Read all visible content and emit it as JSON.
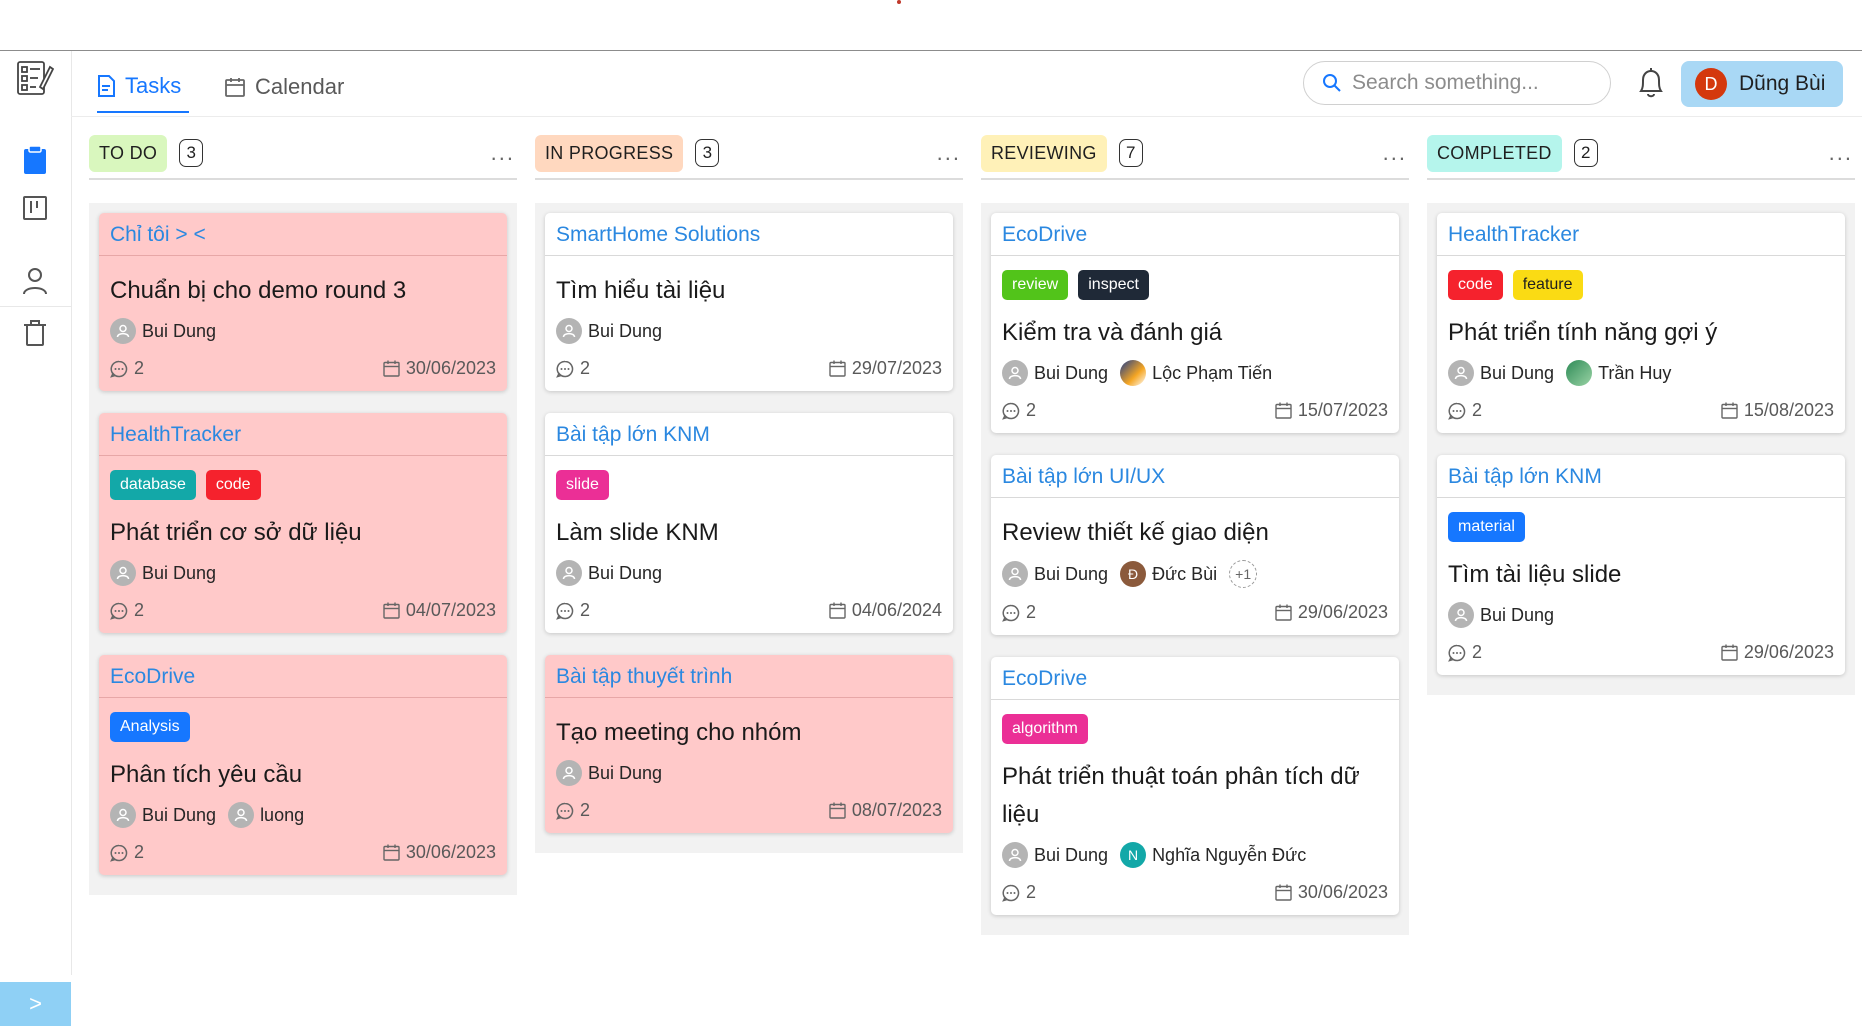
{
  "header": {
    "tabs": [
      {
        "label": "Tasks",
        "icon": "file-text-icon",
        "active": true
      },
      {
        "label": "Calendar",
        "icon": "calendar-icon",
        "active": false
      }
    ],
    "search_placeholder": "Search something...",
    "user": {
      "initial": "D",
      "name": "Dũng Bùi"
    }
  },
  "sidebar": {
    "items": [
      "task-list-icon",
      "clipboard-icon",
      "board-icon",
      "user-icon",
      "trash-icon"
    ],
    "toggle": ">"
  },
  "columns": [
    {
      "title": "TO DO",
      "count": "3",
      "more": "...",
      "color": "#d9f7be",
      "cards": [
        {
          "project": "Chỉ tôi > <",
          "pink": true,
          "tags": [],
          "title": "Chuẩn bị cho demo round 3",
          "assignees": [
            {
              "name": "Bui Dung",
              "style": "gray",
              "initial": ""
            }
          ],
          "comments": "2",
          "date": "30/06/2023"
        },
        {
          "project": "HealthTracker",
          "pink": true,
          "tags": [
            {
              "label": "database",
              "color": "#13a8a8"
            },
            {
              "label": "code",
              "color": "#f5222d"
            }
          ],
          "title": "Phát triển cơ sở dữ liệu",
          "assignees": [
            {
              "name": "Bui Dung",
              "style": "gray",
              "initial": ""
            }
          ],
          "comments": "2",
          "date": "04/07/2023"
        },
        {
          "project": "EcoDrive",
          "pink": true,
          "tags": [
            {
              "label": "Analysis",
              "color": "#1677ff"
            }
          ],
          "title": "Phân tích yêu cầu",
          "assignees": [
            {
              "name": "Bui Dung",
              "style": "gray",
              "initial": ""
            },
            {
              "name": "luong",
              "style": "gray",
              "initial": ""
            }
          ],
          "comments": "2",
          "date": "30/06/2023"
        }
      ]
    },
    {
      "title": "IN PROGRESS",
      "count": "3",
      "more": "...",
      "color": "#ffd8bf",
      "cards": [
        {
          "project": "SmartHome Solutions",
          "pink": false,
          "tags": [],
          "title": "Tìm hiểu tài liệu",
          "assignees": [
            {
              "name": "Bui Dung",
              "style": "gray",
              "initial": ""
            }
          ],
          "comments": "2",
          "date": "29/07/2023"
        },
        {
          "project": "Bài tập lớn KNM",
          "pink": false,
          "tags": [
            {
              "label": "slide",
              "color": "#eb2f96"
            }
          ],
          "title": "Làm slide KNM",
          "assignees": [
            {
              "name": "Bui Dung",
              "style": "gray",
              "initial": ""
            }
          ],
          "comments": "2",
          "date": "04/06/2024"
        },
        {
          "project": "Bài tập thuyết trình",
          "pink": true,
          "tags": [],
          "title": "Tạo meeting cho nhóm",
          "assignees": [
            {
              "name": "Bui Dung",
              "style": "gray",
              "initial": ""
            }
          ],
          "comments": "2",
          "date": "08/07/2023"
        }
      ]
    },
    {
      "title": "REVIEWING",
      "count": "7",
      "more": "...",
      "color": "#fff1b8",
      "cards": [
        {
          "project": "EcoDrive",
          "pink": false,
          "tags": [
            {
              "label": "review",
              "color": "#52c41a"
            },
            {
              "label": "inspect",
              "color": "#1f2937"
            }
          ],
          "title": "Kiểm tra và đánh giá",
          "assignees": [
            {
              "name": "Bui Dung",
              "style": "gray",
              "initial": ""
            },
            {
              "name": "Lộc Phạm Tiến",
              "style": "photo1",
              "initial": ""
            }
          ],
          "comments": "2",
          "date": "15/07/2023"
        },
        {
          "project": "Bài tập lớn UI/UX",
          "pink": false,
          "tags": [],
          "title": "Review thiết kế giao diện",
          "assignees": [
            {
              "name": "Bui Dung",
              "style": "gray",
              "initial": ""
            },
            {
              "name": "Đức Bùi",
              "style": "brown",
              "initial": "Đ"
            }
          ],
          "extra": "+1",
          "comments": "2",
          "date": "29/06/2023"
        },
        {
          "project": "EcoDrive",
          "pink": false,
          "tags": [
            {
              "label": "algorithm",
              "color": "#eb2f96"
            }
          ],
          "title": "Phát triển thuật toán phân tích dữ liệu",
          "assignees": [
            {
              "name": "Bui Dung",
              "style": "gray",
              "initial": ""
            },
            {
              "name": "Nghĩa Nguyễn Đức",
              "style": "teal",
              "initial": "N"
            }
          ],
          "comments": "2",
          "date": "30/06/2023"
        }
      ]
    },
    {
      "title": "COMPLETED",
      "count": "2",
      "more": "...",
      "color": "#b5f5ec",
      "cards": [
        {
          "project": "HealthTracker",
          "pink": false,
          "tags": [
            {
              "label": "code",
              "color": "#f5222d"
            },
            {
              "label": "feature",
              "color": "#fadb14",
              "text": "#1f1f1f"
            }
          ],
          "title": "Phát triển tính năng gợi ý",
          "assignees": [
            {
              "name": "Bui Dung",
              "style": "gray",
              "initial": ""
            },
            {
              "name": "Trần Huy",
              "style": "photo2",
              "initial": ""
            }
          ],
          "comments": "2",
          "date": "15/08/2023"
        },
        {
          "project": "Bài tập lớn KNM",
          "pink": false,
          "tags": [
            {
              "label": "material",
              "color": "#1677ff"
            }
          ],
          "title": "Tìm tài liệu slide",
          "assignees": [
            {
              "name": "Bui Dung",
              "style": "gray",
              "initial": ""
            }
          ],
          "comments": "2",
          "date": "29/06/2023"
        }
      ]
    }
  ]
}
